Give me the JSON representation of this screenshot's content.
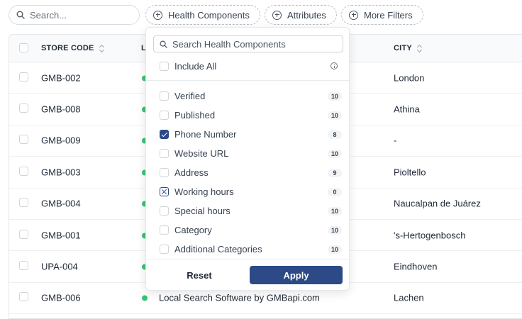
{
  "search": {
    "placeholder": "Search..."
  },
  "filters": [
    {
      "label": "Health Components",
      "icon": "plus-circle-icon"
    },
    {
      "label": "Attributes",
      "icon": "plus-circle-icon"
    },
    {
      "label": "More Filters",
      "icon": "plus-circle-icon"
    }
  ],
  "table": {
    "columns": [
      {
        "label": "STORE CODE"
      },
      {
        "label": "LO"
      },
      {
        "label": "CITY"
      }
    ],
    "rows": [
      {
        "store_code": "GMB-002",
        "location": "",
        "city": "London"
      },
      {
        "store_code": "GMB-008",
        "location": "",
        "city": "Athina"
      },
      {
        "store_code": "GMB-009",
        "location": "",
        "city": "-"
      },
      {
        "store_code": "GMB-003",
        "location": "",
        "city": "Pioltello"
      },
      {
        "store_code": "GMB-004",
        "location": "",
        "city": "Naucalpan de Juárez"
      },
      {
        "store_code": "GMB-001",
        "location": "",
        "city": "'s-Hertogenbosch"
      },
      {
        "store_code": "UPA-004",
        "location": "",
        "city": "Eindhoven"
      },
      {
        "store_code": "GMB-006",
        "location": "Local Search Software by GMBapi.com",
        "city": "Lachen"
      }
    ],
    "status_color": "#34c472"
  },
  "dropdown": {
    "search_placeholder": "Search Health Components",
    "include_all_label": "Include All",
    "items": [
      {
        "label": "Verified",
        "count": "10",
        "state": "unchecked"
      },
      {
        "label": "Published",
        "count": "10",
        "state": "unchecked"
      },
      {
        "label": "Phone Number",
        "count": "8",
        "state": "checked"
      },
      {
        "label": "Website URL",
        "count": "10",
        "state": "unchecked"
      },
      {
        "label": "Address",
        "count": "9",
        "state": "unchecked"
      },
      {
        "label": "Working hours",
        "count": "0",
        "state": "excluded"
      },
      {
        "label": "Special hours",
        "count": "10",
        "state": "unchecked"
      },
      {
        "label": "Category",
        "count": "10",
        "state": "unchecked"
      },
      {
        "label": "Additional Categories",
        "count": "10",
        "state": "unchecked"
      }
    ],
    "reset_label": "Reset",
    "apply_label": "Apply",
    "accent_color": "#2b4a86"
  }
}
